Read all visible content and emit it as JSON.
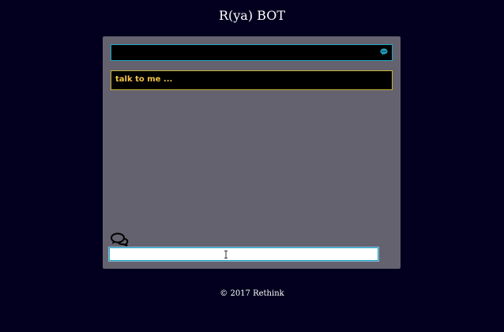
{
  "header": {
    "title": "R(ya) BOT"
  },
  "chat": {
    "bot_message": "talk to me ...",
    "input_value": "",
    "bubble_icon": "chat-bubble-icon",
    "conversation_icon": "conversation-icon"
  },
  "footer": {
    "copyright": "© 2017 Rethink"
  },
  "colors": {
    "background": "#02001e",
    "panel": "#64626f",
    "accent": "#1aa6c4",
    "message_text": "#f2c24a"
  }
}
